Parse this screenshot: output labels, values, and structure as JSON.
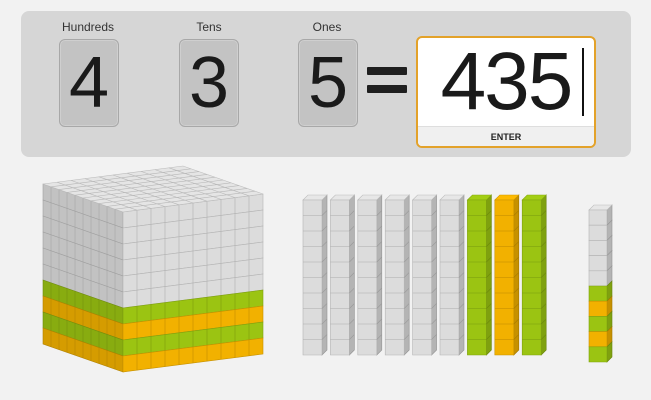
{
  "places": [
    {
      "label": "Hundreds",
      "digit": "4"
    },
    {
      "label": "Tens",
      "digit": "3"
    },
    {
      "label": "Ones",
      "digit": "5"
    }
  ],
  "equals_sign": "=",
  "answer": {
    "value": "435",
    "enter_label": "ENTER"
  },
  "blocks": {
    "hundreds": {
      "count": 4,
      "layer_colors": [
        "#9bc412",
        "#f2b100",
        "#9bc412",
        "#f2b100"
      ]
    },
    "tens": {
      "count": 3,
      "rod_colors": [
        "#9bc412",
        "#f2b100",
        "#9bc412"
      ],
      "gray_rods": 6
    },
    "ones": {
      "count": 5,
      "cube_colors": [
        "#9bc412",
        "#f2b100",
        "#9bc412",
        "#f2b100",
        "#9bc412"
      ],
      "gray_cubes": 5
    }
  },
  "colors": {
    "gray_block": "#dcdcdc",
    "green": "#9bc412",
    "orange": "#f2b100",
    "accent": "#e3a22a"
  }
}
